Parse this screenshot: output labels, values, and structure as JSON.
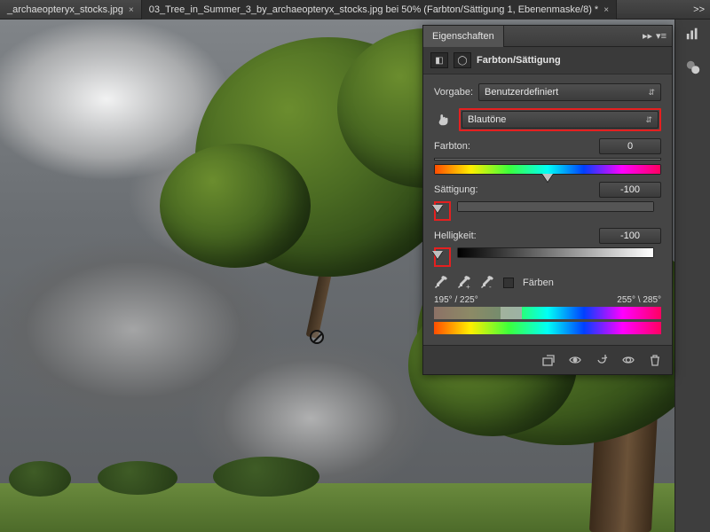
{
  "tabs": [
    {
      "label": "_archaeopteryx_stocks.jpg",
      "active": false
    },
    {
      "label": "03_Tree_in_Summer_3_by_archaeopteryx_stocks.jpg bei 50% (Farbton/Sättigung 1, Ebenenmaske/8) *",
      "active": true
    }
  ],
  "panel": {
    "title": "Eigenschaften",
    "adjustment_title": "Farbton/Sättigung",
    "preset_label": "Vorgabe:",
    "preset_value": "Benutzerdefiniert",
    "channel_value": "Blautöne",
    "sliders": {
      "hue": {
        "label": "Farbton:",
        "value": "0",
        "position_pct": 50
      },
      "saturation": {
        "label": "Sättigung:",
        "value": "-100",
        "position_pct": 0
      },
      "lightness": {
        "label": "Helligkeit:",
        "value": "-100",
        "position_pct": 0
      }
    },
    "colorize_label": "Färben",
    "range": {
      "left": "195° / 225°",
      "right": "255° \\ 285°"
    }
  }
}
